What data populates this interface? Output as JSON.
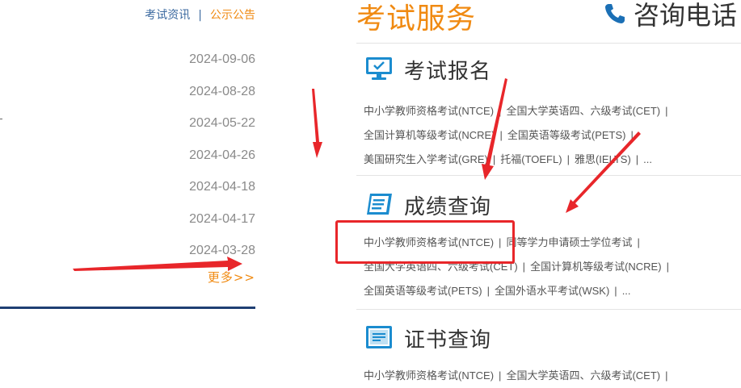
{
  "left": {
    "tabs": {
      "news": "考试资讯",
      "separator": "|",
      "notice": "公示公告"
    },
    "dates": [
      "2024-09-06",
      "2024-08-28",
      "2024-05-22",
      "2024-04-26",
      "2024-04-18",
      "2024-04-17",
      "2024-03-28"
    ],
    "more": "更多>>"
  },
  "right": {
    "title": "考试服务",
    "hotline": "咨询电话",
    "sections": [
      {
        "id": "registration",
        "title": "考试报名",
        "icon": "monitor-check-icon",
        "rows": [
          [
            "中小学教师资格考试(NTCE)",
            "全国大学英语四、六级考试(CET)",
            ""
          ],
          [
            "全国计算机等级考试(NCRE)",
            "全国英语等级考试(PETS)",
            ""
          ],
          [
            "美国研究生入学考试(GRE)",
            "托福(TOEFL)",
            "雅思(IELTS)",
            "..."
          ]
        ]
      },
      {
        "id": "scores",
        "title": "成绩查询",
        "icon": "document-icon",
        "rows": [
          [
            "中小学教师资格考试(NTCE)",
            "同等学力申请硕士学位考试",
            ""
          ],
          [
            "全国大学英语四、六级考试(CET)",
            "全国计算机等级考试(NCRE)",
            ""
          ],
          [
            "全国英语等级考试(PETS)",
            "全国外语水平考试(WSK)",
            "..."
          ]
        ]
      },
      {
        "id": "certificates",
        "title": "证书查询",
        "icon": "certificate-icon",
        "rows": [
          [
            "中小学教师资格考试(NTCE)",
            "全国大学英语四、六级考试(CET)",
            ""
          ]
        ]
      }
    ]
  },
  "colors": {
    "accent": "#f08a12",
    "brand_blue": "#1f3f73",
    "annotation_red": "#e8262a",
    "icon_blue": "#1b8ccf"
  }
}
